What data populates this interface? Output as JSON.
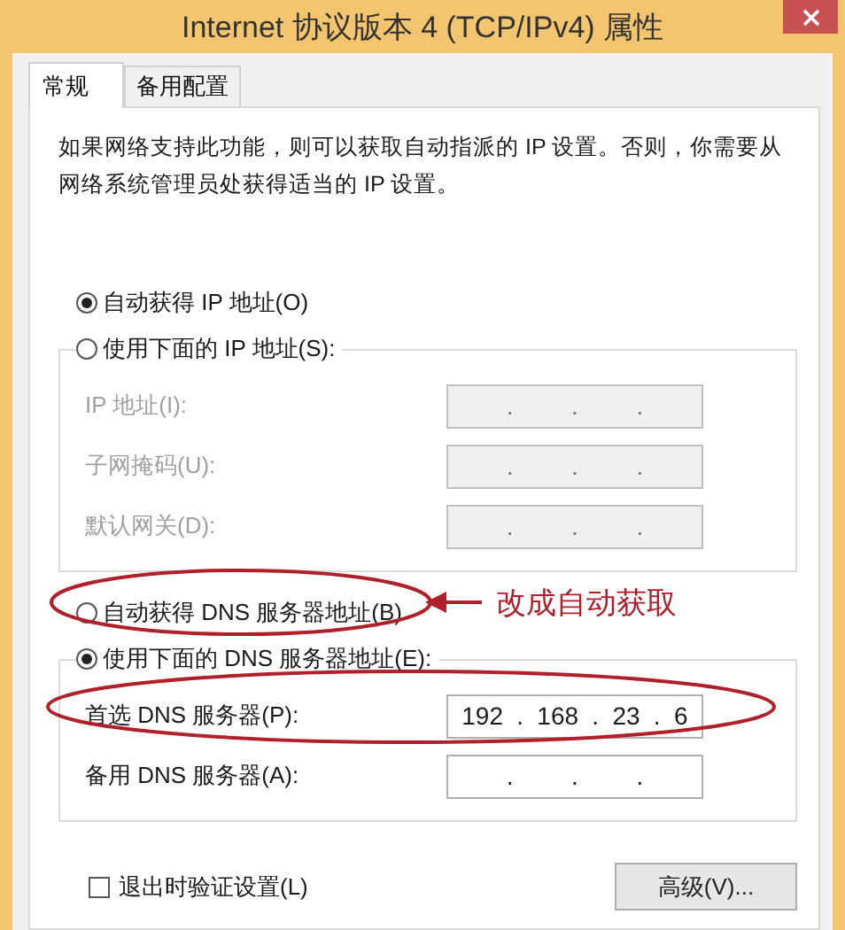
{
  "window": {
    "title": "Internet 协议版本 4 (TCP/IPv4) 属性"
  },
  "tabs": [
    {
      "label": "常规",
      "selected": true
    },
    {
      "label": "备用配置",
      "selected": false
    }
  ],
  "description": "如果网络支持此功能，则可以获取自动指派的 IP 设置。否则，你需要从网络系统管理员处获得适当的 IP 设置。",
  "ip_section": {
    "options": [
      {
        "label": "自动获得 IP 地址(O)",
        "selected": true
      },
      {
        "label": "使用下面的 IP 地址(S):",
        "selected": false
      }
    ],
    "fields": [
      {
        "label": "IP 地址(I):",
        "parts": [
          ".",
          ".",
          "."
        ],
        "disabled": true
      },
      {
        "label": "子网掩码(U):",
        "parts": [
          ".",
          ".",
          "."
        ],
        "disabled": true
      },
      {
        "label": "默认网关(D):",
        "parts": [
          ".",
          ".",
          "."
        ],
        "disabled": true
      }
    ]
  },
  "dns_section": {
    "options": [
      {
        "label": "自动获得 DNS 服务器地址(B)",
        "selected": false
      },
      {
        "label": "使用下面的 DNS 服务器地址(E):",
        "selected": true
      }
    ],
    "fields": [
      {
        "label": "首选 DNS 服务器(P):",
        "parts": [
          "192",
          ".",
          "168",
          ".",
          "23",
          ".",
          "6"
        ],
        "disabled": false
      },
      {
        "label": "备用 DNS 服务器(A):",
        "parts": [
          ".",
          ".",
          "."
        ],
        "disabled": false
      }
    ]
  },
  "validate_on_exit": {
    "label": "退出时验证设置(L)",
    "checked": false
  },
  "advanced_button": "高级(V)...",
  "annotation": {
    "note": "改成自动获取"
  }
}
